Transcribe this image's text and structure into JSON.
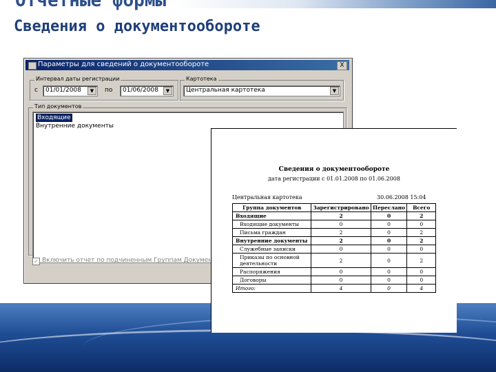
{
  "slide": {
    "heading": "Отчетные формы",
    "subheading": "Сведения о документообороте"
  },
  "dialog": {
    "title": "Параметры для сведений о документообороте",
    "close_label": "X",
    "date_group": {
      "legend": "Интервал даты регистрации",
      "from_label": "с",
      "from_value": "01/01/2008",
      "to_label": "по",
      "to_value": "01/06/2008"
    },
    "card_group": {
      "legend": "Картотека",
      "value": "Центральная картотека"
    },
    "doc_types": {
      "legend": "Тип документов",
      "items": [
        {
          "label": "Входящие",
          "selected": true
        },
        {
          "label": "Внутренние документы",
          "selected": false
        }
      ]
    },
    "checkbox_label": "Включить отчет по подчиненным Группам Документов",
    "checkbox_mark": "✓"
  },
  "report": {
    "title": "Сведения о документообороте",
    "period": "дата регистрации с 01.01.2008 по 01.06.2008",
    "card": "Центральная картотека",
    "timestamp": "30.06.2008 15:04",
    "columns": [
      "Группа документов",
      "Зарегистрировано",
      "Переслано",
      "Всего"
    ],
    "rows": [
      {
        "name": "Входящие",
        "registered": "2",
        "forwarded": "0",
        "total": "2",
        "kind": "grp"
      },
      {
        "name": "Входящие документы",
        "registered": "0",
        "forwarded": "0",
        "total": "0",
        "kind": "sub"
      },
      {
        "name": "Письма граждан",
        "registered": "2",
        "forwarded": "0",
        "total": "2",
        "kind": "sub"
      },
      {
        "name": "Внутренние документы",
        "registered": "2",
        "forwarded": "0",
        "total": "2",
        "kind": "grp"
      },
      {
        "name": "Служебные записки",
        "registered": "0",
        "forwarded": "0",
        "total": "0",
        "kind": "sub"
      },
      {
        "name": "Приказы по основной деятельности",
        "registered": "2",
        "forwarded": "0",
        "total": "2",
        "kind": "sub"
      },
      {
        "name": "Распоряжения",
        "registered": "0",
        "forwarded": "0",
        "total": "0",
        "kind": "sub"
      },
      {
        "name": "Договоры",
        "registered": "0",
        "forwarded": "0",
        "total": "0",
        "kind": "sub"
      },
      {
        "name": "Итого:",
        "registered": "4",
        "forwarded": "0",
        "total": "4",
        "kind": "total"
      }
    ]
  }
}
